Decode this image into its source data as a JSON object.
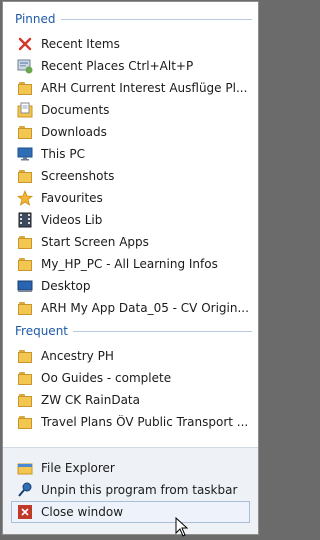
{
  "pinned": {
    "title": "Pinned",
    "items": [
      {
        "label": "Recent Items",
        "icon": "recent-items-icon"
      },
      {
        "label": "Recent Places Ctrl+Alt+P",
        "icon": "recent-places-icon"
      },
      {
        "label": "ARH Current Interest Ausflüge Pl...",
        "icon": "folder-icon"
      },
      {
        "label": "Documents",
        "icon": "documents-icon"
      },
      {
        "label": "Downloads",
        "icon": "downloads-icon"
      },
      {
        "label": "This PC",
        "icon": "this-pc-icon"
      },
      {
        "label": "Screenshots",
        "icon": "folder-icon"
      },
      {
        "label": "Favourites",
        "icon": "favourites-star-icon"
      },
      {
        "label": "Videos Lib",
        "icon": "videos-library-icon"
      },
      {
        "label": "Start Screen Apps",
        "icon": "folder-icon"
      },
      {
        "label": "My_HP_PC - All Learning Infos",
        "icon": "folder-icon"
      },
      {
        "label": "Desktop",
        "icon": "desktop-icon"
      },
      {
        "label": "ARH My App Data_05 - CV Origin...",
        "icon": "folder-icon"
      }
    ]
  },
  "frequent": {
    "title": "Frequent",
    "items": [
      {
        "label": "Ancestry PH",
        "icon": "folder-icon"
      },
      {
        "label": "Oo Guides - complete",
        "icon": "folder-icon"
      },
      {
        "label": "ZW CK RainData",
        "icon": "folder-icon"
      },
      {
        "label": "Travel Plans ÖV Public Transport ...",
        "icon": "folder-icon"
      }
    ]
  },
  "tasks": {
    "file_explorer": "File Explorer",
    "unpin": "Unpin this program from taskbar",
    "close": "Close window"
  },
  "colors": {
    "header_text": "#1e5aa8",
    "folder_yellow": "#f3c74f",
    "close_red": "#c0392b"
  }
}
